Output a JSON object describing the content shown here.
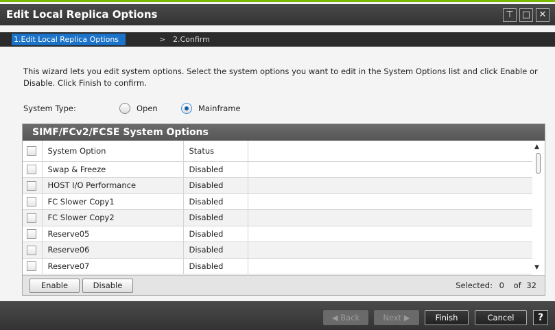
{
  "window": {
    "title": "Edit Local Replica Options",
    "accent": "#7ab800"
  },
  "titlebar_icons": [
    "pin-icon",
    "maximize-icon",
    "close-icon"
  ],
  "wizard": {
    "steps": [
      "1.Edit Local Replica Options",
      "2.Confirm"
    ],
    "separator": ">",
    "active_color": "#1a73c9"
  },
  "description": "This wizard lets you edit system options. Select the system options you want to edit in the System Options list and click Enable or Disable. Click Finish to confirm.",
  "system_type": {
    "label": "System Type:",
    "options": [
      "Open",
      "Mainframe"
    ],
    "selected": "Mainframe"
  },
  "options_panel": {
    "title": "SIMF/FCv2/FCSE System Options",
    "columns": [
      "System Option",
      "Status"
    ],
    "rows": [
      {
        "option": "Swap & Freeze",
        "status": "Disabled"
      },
      {
        "option": "HOST I/O Performance",
        "status": "Disabled"
      },
      {
        "option": "FC Slower Copy1",
        "status": "Disabled"
      },
      {
        "option": "FC Slower Copy2",
        "status": "Disabled"
      },
      {
        "option": "Reserve05",
        "status": "Disabled"
      },
      {
        "option": "Reserve06",
        "status": "Disabled"
      },
      {
        "option": "Reserve07",
        "status": "Disabled"
      }
    ],
    "enable_label": "Enable",
    "disable_label": "Disable",
    "selected_text": "Selected:",
    "selected_count": "0",
    "of_text": "of",
    "total_count": "32"
  },
  "footer": {
    "back_label": "Back",
    "next_label": "Next",
    "finish_label": "Finish",
    "cancel_label": "Cancel",
    "help_label": "?"
  }
}
